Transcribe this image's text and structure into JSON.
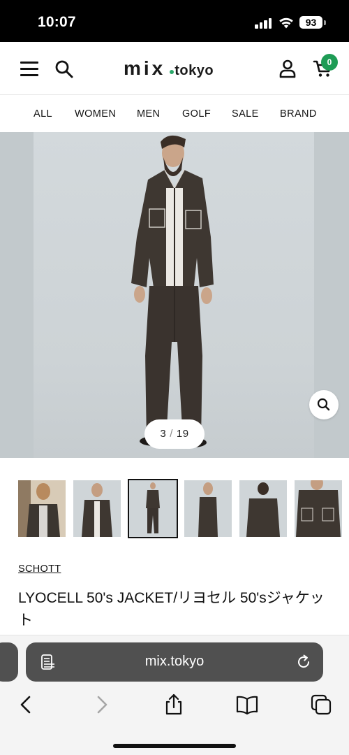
{
  "status_bar": {
    "time": "10:07",
    "battery": "93"
  },
  "header": {
    "logo_main": "mix",
    "logo_sub": "tokyo",
    "cart_count": "0"
  },
  "nav": {
    "items": [
      "ALL",
      "WOMEN",
      "MEN",
      "GOLF",
      "SALE",
      "BRAND"
    ]
  },
  "gallery": {
    "current": "3",
    "separator": "/",
    "total": "19",
    "thumbnail_count": 6,
    "active_thumbnail": 3
  },
  "product": {
    "brand": "SCHOTT",
    "title": "LYOCELL 50's JACKET/リヨセル 50'sジャケット"
  },
  "browser": {
    "url": "mix.tokyo"
  },
  "colors": {
    "accent_green": "#1e9c55",
    "url_bar": "#505050",
    "hero_bg": "#cfd6d9"
  },
  "icons": [
    "menu-icon",
    "search-icon",
    "account-icon",
    "cart-icon",
    "zoom-icon",
    "reader-icon",
    "reload-icon",
    "back-icon",
    "forward-icon",
    "share-icon",
    "bookmarks-icon",
    "tabs-icon"
  ]
}
